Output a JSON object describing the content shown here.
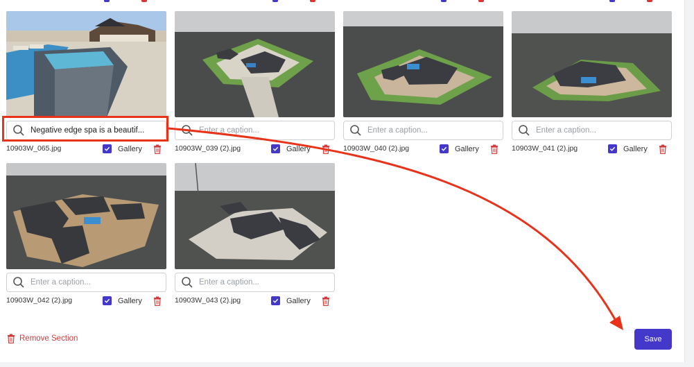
{
  "photos": [
    {
      "filename": "10903W_065.jpg",
      "caption_value": "Negative edge spa is a beautif...",
      "caption_placeholder": "Enter a caption...",
      "gallery_label": "Gallery",
      "gallery_checked": true,
      "thumb": "pool"
    },
    {
      "filename": "10903W_039 (2).jpg",
      "caption_value": "",
      "caption_placeholder": "Enter a caption...",
      "gallery_label": "Gallery",
      "gallery_checked": true,
      "thumb": "aerial"
    },
    {
      "filename": "10903W_040 (2).jpg",
      "caption_value": "",
      "caption_placeholder": "Enter a caption...",
      "gallery_label": "Gallery",
      "gallery_checked": true,
      "thumb": "aerial"
    },
    {
      "filename": "10903W_041 (2).jpg",
      "caption_value": "",
      "caption_placeholder": "Enter a caption...",
      "gallery_label": "Gallery",
      "gallery_checked": true,
      "thumb": "aerial"
    },
    {
      "filename": "10903W_042 (2).jpg",
      "caption_value": "",
      "caption_placeholder": "Enter a caption...",
      "gallery_label": "Gallery",
      "gallery_checked": true,
      "thumb": "aerial"
    },
    {
      "filename": "10903W_043 (2).jpg",
      "caption_value": "",
      "caption_placeholder": "Enter a caption...",
      "gallery_label": "Gallery",
      "gallery_checked": true,
      "thumb": "aerial"
    }
  ],
  "section": {
    "remove_label": "Remove Section"
  },
  "actions": {
    "save_label": "Save"
  },
  "colors": {
    "accent": "#4338ca",
    "danger": "#d63a3a",
    "annotation": "#e8331a"
  },
  "icons": {
    "caption": "search-icon",
    "delete": "trash-icon",
    "gallery": "checkbox-checked-icon"
  }
}
